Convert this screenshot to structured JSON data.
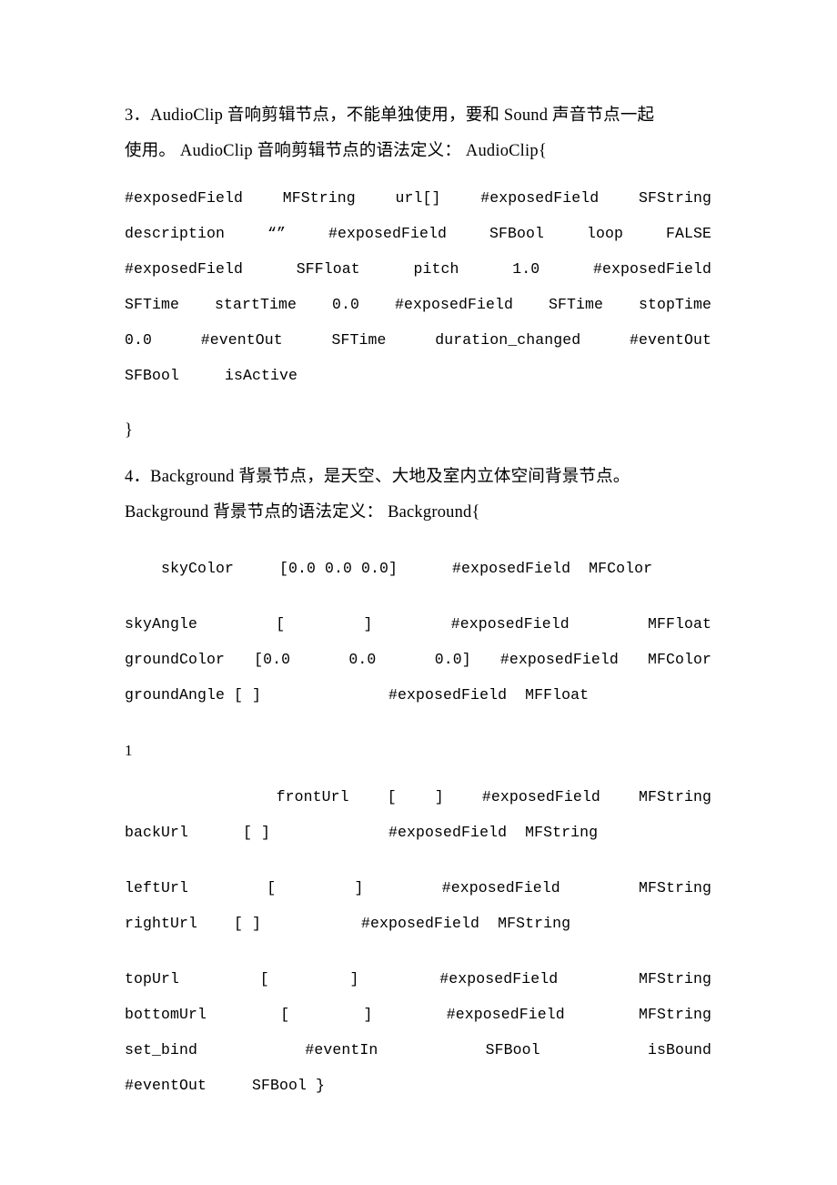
{
  "document": {
    "background_color": "#ffffff",
    "text_color": "#000000",
    "page_number": "1"
  },
  "sections": {
    "audioclip": {
      "paragraph_line_1": "3．AudioClip 音响剪辑节点，不能单独使用，要和 Sound 声音节点一起",
      "paragraph_line_2": "使用。 AudioClip 音响剪辑节点的语法定义： AudioClip{",
      "code_lines": [
        {
          "tokens": [
            "#exposedField",
            "MFString",
            "url[]",
            "#exposedField",
            "SFString"
          ]
        },
        {
          "tokens": [
            "description",
            "“”",
            "#exposedField",
            "SFBool",
            "loop",
            "FALSE"
          ]
        },
        {
          "tokens": [
            "#exposedField",
            "SFFloat",
            "pitch",
            "1.0",
            "#exposedField"
          ]
        },
        {
          "tokens": [
            "SFTime",
            "startTime",
            "0.0",
            "#exposedField",
            "SFTime",
            "stopTime"
          ]
        },
        {
          "tokens": [
            "0.0",
            "#eventOut",
            "SFTime",
            "duration_changed",
            "#eventOut"
          ]
        }
      ],
      "code_last_line": "SFBool     isActive",
      "closing_brace": "}"
    },
    "background": {
      "paragraph_line_1": "4．Background 背景节点，是天空、大地及室内立体空间背景节点。",
      "paragraph_line_2": "Background 背景节点的语法定义： Background{",
      "code_group_1": [
        "    skyColor     [0.0 0.0 0.0]      #exposedField  MFColor"
      ],
      "code_group_2": [
        {
          "tokens": [
            "skyAngle",
            "[ ]",
            "#exposedField",
            "MFFloat"
          ]
        },
        {
          "tokens": [
            "groundColor",
            "[0.0  0.0  0.0]",
            "#exposedField",
            "MFColor"
          ]
        },
        {
          "tokens": [
            "groundAngle [ ]",
            "#exposedField",
            "MFFloat"
          ],
          "plain": true,
          "text": "groundAngle [ ]              #exposedField  MFFloat"
        }
      ],
      "code_group_3": [
        {
          "tokens": [
            "    frontUrl",
            "[ ]",
            "#exposedField",
            "MFString"
          ]
        },
        {
          "tokens": [
            "backUrl",
            "[ ]",
            "#exposedField",
            "MFString"
          ],
          "plain": true,
          "text": "backUrl      [ ]             #exposedField  MFString"
        }
      ],
      "code_group_4": [
        {
          "tokens": [
            "leftUrl",
            "[ ]",
            "#exposedField",
            "MFString"
          ]
        },
        {
          "tokens": [
            "rightUrl",
            "[ ]",
            "#exposedField",
            "MFString"
          ],
          "plain": true,
          "text": "rightUrl    [ ]           #exposedField  MFString"
        }
      ],
      "code_group_5": [
        {
          "tokens": [
            "topUrl",
            "[ ]",
            "#exposedField",
            "MFString"
          ]
        },
        {
          "tokens": [
            "bottomUrl",
            "[ ]",
            "#exposedField",
            "MFString"
          ]
        },
        {
          "tokens": [
            "set_bind",
            "#eventIn",
            "SFBool",
            "isBound"
          ]
        }
      ],
      "code_last_line": "#eventOut     SFBool }"
    }
  }
}
